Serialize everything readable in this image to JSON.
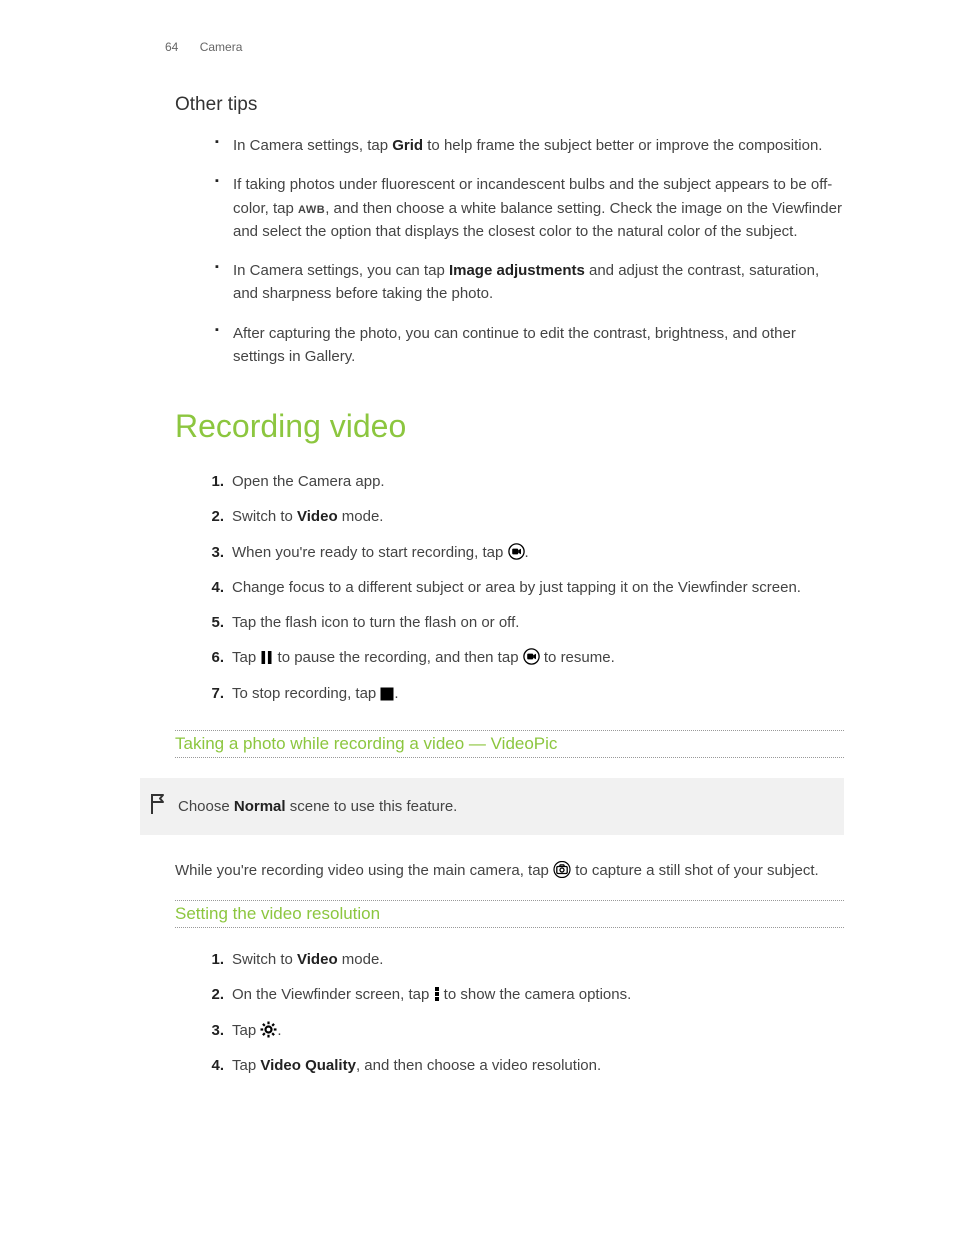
{
  "header": {
    "page_number": "64",
    "section": "Camera"
  },
  "other_tips": {
    "heading": "Other tips",
    "items": [
      {
        "pre": "In Camera settings, tap ",
        "bold": "Grid",
        "post": " to help frame the subject better or improve the composition."
      },
      {
        "pre": "If taking photos under fluorescent or incandescent bulbs and the subject appears to be off-color, tap ",
        "awb": "AWB",
        "post": ", and then choose a white balance setting. Check the image on the Viewfinder and select the option that displays the closest color to the natural color of the subject."
      },
      {
        "pre": "In Camera settings, you can tap ",
        "bold": "Image adjustments",
        "post": " and adjust the contrast, saturation, and sharpness before taking the photo."
      },
      {
        "text": "After capturing the photo, you can continue to edit the contrast, brightness, and other settings in Gallery."
      }
    ]
  },
  "recording_video": {
    "heading": "Recording video",
    "steps": {
      "s1": "Open the Camera app.",
      "s2_pre": "Switch to ",
      "s2_bold": "Video",
      "s2_post": " mode.",
      "s3_pre": "When you're ready to start recording, tap ",
      "s3_post": ".",
      "s4": "Change focus to a different subject or area by just tapping it on the Viewfinder screen.",
      "s5": "Tap the flash icon to turn the flash on or off.",
      "s6_pre": "Tap ",
      "s6_mid": " to pause the recording, and then tap ",
      "s6_post": " to resume.",
      "s7_pre": "To stop recording, tap ",
      "s7_post": "."
    }
  },
  "videopic": {
    "heading": "Taking a photo while recording a video — VideoPic",
    "flag_pre": "Choose ",
    "flag_bold": "Normal",
    "flag_post": " scene to use this feature.",
    "body_pre": "While you're recording video using the main camera, tap ",
    "body_post": " to capture a still shot of your subject."
  },
  "resolution": {
    "heading": "Setting the video resolution",
    "s1_pre": "Switch to ",
    "s1_bold": "Video",
    "s1_post": " mode.",
    "s2_pre": "On the Viewfinder screen, tap ",
    "s2_post": " to show the camera options.",
    "s3_pre": "Tap ",
    "s3_post": ".",
    "s4_pre": "Tap ",
    "s4_bold": "Video Quality",
    "s4_post": ", and then choose a video resolution."
  }
}
